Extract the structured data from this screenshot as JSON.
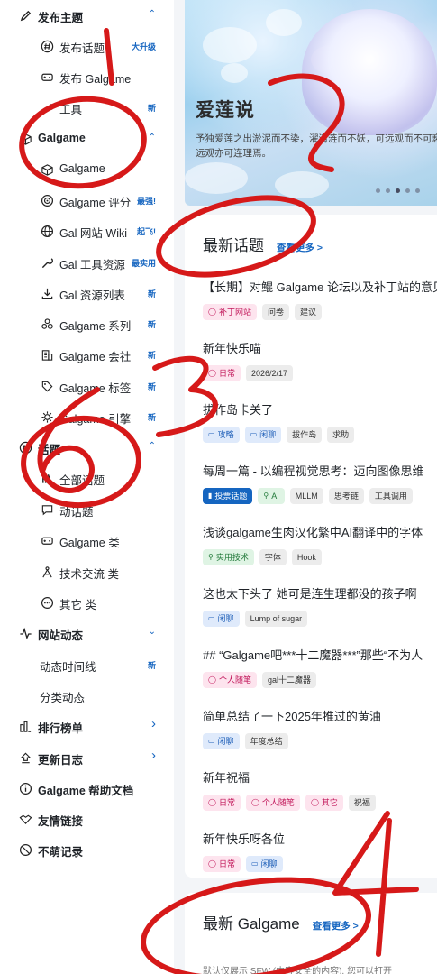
{
  "sidebar": {
    "items": [
      {
        "label": "发布主题",
        "icon": "pencil-icon",
        "bold": true,
        "chevron": "up"
      },
      {
        "label": "发布话题",
        "icon": "hash-icon",
        "badge": "大升级"
      },
      {
        "label": "发布 Galgame",
        "icon": "gamepad-icon"
      },
      {
        "label": "工具",
        "icon": "tool-icon",
        "badge": "新"
      },
      {
        "label": "Galgame",
        "icon": "cube-icon",
        "bold": true,
        "chevron": "up"
      },
      {
        "label": "Galgame",
        "icon": "cube-icon"
      },
      {
        "label": "Galgame 评分",
        "icon": "rating-icon",
        "badge": "最强!"
      },
      {
        "label": "Gal 网站 Wiki",
        "icon": "globe-icon",
        "badge": "起飞!"
      },
      {
        "label": "Gal 工具资源",
        "icon": "wrench-icon",
        "badge": "最实用"
      },
      {
        "label": "Gal 资源列表",
        "icon": "download-icon",
        "badge": "新"
      },
      {
        "label": "Galgame 系列",
        "icon": "cluster-icon",
        "badge": "新"
      },
      {
        "label": "Galgame 会社",
        "icon": "building-icon",
        "badge": "新"
      },
      {
        "label": "Galgame 标签",
        "icon": "tag-icon",
        "badge": "新"
      },
      {
        "label": "Galgame 引擎",
        "icon": "engine-icon",
        "badge": "新"
      },
      {
        "label": "话题",
        "icon": "hash-icon",
        "bold": true,
        "chevron": "up"
      },
      {
        "label": "全部话题",
        "icon": "library-icon"
      },
      {
        "label": "动话题",
        "icon": "chat-icon"
      },
      {
        "label": "Galgame 类",
        "icon": "gamepad-icon"
      },
      {
        "label": "技术交流 类",
        "icon": "tech-icon"
      },
      {
        "label": "其它 类",
        "icon": "more-icon"
      },
      {
        "label": "网站动态",
        "icon": "activity-icon",
        "bold": true,
        "chevron": "down"
      },
      {
        "label": "动态时间线",
        "icon": "",
        "badge": "新"
      },
      {
        "label": "分类动态",
        "icon": ""
      },
      {
        "label": "排行榜单",
        "icon": "ranking-icon",
        "bold": true,
        "chevron": "right"
      },
      {
        "label": "更新日志",
        "icon": "update-icon",
        "bold": true,
        "chevron": "right"
      },
      {
        "label": "Galgame 帮助文档",
        "icon": "info-icon",
        "bold": true
      },
      {
        "label": "友情链接",
        "icon": "handshake-icon",
        "bold": true
      },
      {
        "label": "不萌记录",
        "icon": "ban-icon",
        "bold": true
      }
    ]
  },
  "banner": {
    "title": "爱莲说",
    "text_line1": "予独爱莲之出淤泥而不染，濯清涟而不妖，可远观而不可亵玩焉，",
    "text_line2": "远观亦可连理焉。"
  },
  "latest_topics": {
    "title": "最新话题",
    "more": "查看更多 >",
    "topics": [
      {
        "title": "【长期】对鲲 Galgame 论坛以及补丁站的意见",
        "tags": [
          {
            "text": "补丁网站",
            "style": "c-pink",
            "icon": "circle"
          },
          {
            "text": "问卷",
            "style": "c-gray"
          },
          {
            "text": "建议",
            "style": "c-gray"
          }
        ]
      },
      {
        "title": "新年快乐喵",
        "tags": [
          {
            "text": "日常",
            "style": "c-pink",
            "icon": "circle"
          },
          {
            "text": "2026/2/17",
            "style": "c-gray"
          }
        ]
      },
      {
        "title": "拔作岛卡关了",
        "tags": [
          {
            "text": "攻略",
            "style": "c-blue",
            "icon": "pad"
          },
          {
            "text": "闲聊",
            "style": "c-blue",
            "icon": "pad"
          },
          {
            "text": "拔作岛",
            "style": "c-gray"
          },
          {
            "text": "求助",
            "style": "c-gray"
          }
        ]
      },
      {
        "title": "每周一篇 - 以编程视觉思考：迈向图像思维",
        "tags": [
          {
            "text": "投票话题",
            "style": "c-blue-solid",
            "icon": "chart"
          },
          {
            "text": "AI",
            "style": "c-green",
            "icon": "tech"
          },
          {
            "text": "MLLM",
            "style": "c-gray"
          },
          {
            "text": "思考链",
            "style": "c-gray"
          },
          {
            "text": "工具调用",
            "style": "c-gray"
          }
        ]
      },
      {
        "title": "浅谈galgame生肉汉化繁中AI翻译中的字体",
        "tags": [
          {
            "text": "实用技术",
            "style": "c-green",
            "icon": "tech"
          },
          {
            "text": "字体",
            "style": "c-gray"
          },
          {
            "text": "Hook",
            "style": "c-gray"
          }
        ]
      },
      {
        "title": "这也太下头了 她可是连生理都没的孩子啊",
        "tags": [
          {
            "text": "闲聊",
            "style": "c-blue",
            "icon": "pad"
          },
          {
            "text": "Lump of sugar",
            "style": "c-gray"
          }
        ]
      },
      {
        "title": "## “Galgame吧***十二魔器***”那些“不为人",
        "tags": [
          {
            "text": "个人随笔",
            "style": "c-pink",
            "icon": "circle"
          },
          {
            "text": "gal十二魔器",
            "style": "c-gray"
          }
        ]
      },
      {
        "title": "简单总结了一下2025年推过的黄油",
        "tags": [
          {
            "text": "闲聊",
            "style": "c-blue",
            "icon": "pad"
          },
          {
            "text": "年度总结",
            "style": "c-gray"
          }
        ]
      },
      {
        "title": "新年祝福",
        "tags": [
          {
            "text": "日常",
            "style": "c-pink",
            "icon": "circle"
          },
          {
            "text": "个人随笔",
            "style": "c-pink",
            "icon": "circle"
          },
          {
            "text": "其它",
            "style": "c-pink",
            "icon": "circle"
          },
          {
            "text": "祝福",
            "style": "c-gray"
          }
        ]
      },
      {
        "title": "新年快乐呀各位",
        "tags": [
          {
            "text": "日常",
            "style": "c-pink",
            "icon": "circle"
          },
          {
            "text": "闲聊",
            "style": "c-blue",
            "icon": "pad"
          }
        ]
      }
    ]
  },
  "latest_games": {
    "title": "最新 Galgame",
    "more": "查看更多 >",
    "desc": "默认仅展示 SFW (内容安全的内容), 您可以打开"
  },
  "annotations": {
    "color": "#d61919",
    "numbers": [
      "1",
      "2",
      "3",
      "4",
      "6"
    ]
  }
}
